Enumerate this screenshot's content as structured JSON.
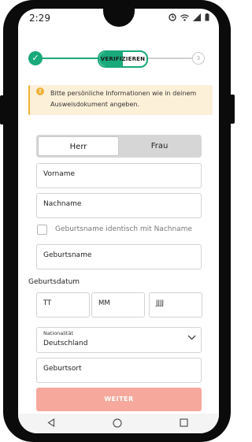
{
  "status_bar": {
    "time": "2:29",
    "icons": [
      "alarm-icon",
      "wifi-icon",
      "signal-icon",
      "battery-icon"
    ]
  },
  "stepper": {
    "done_icon": "✓",
    "current_label": "VERIFIZIEREN",
    "next_number": "3"
  },
  "alert": {
    "icon": "!",
    "text": "Bitte persönliche Informationen wie in deinem Ausweisdokument angeben."
  },
  "gender": {
    "options": [
      "Herr",
      "Frau"
    ],
    "selected": "Herr"
  },
  "fields": {
    "first_name": "Vorname",
    "last_name": "Nachname",
    "birth_name_checkbox": "Geburtsname identisch mit Nachname",
    "birth_name": "Geburtsname"
  },
  "birthdate": {
    "label": "Geburtsdatum",
    "day": "TT",
    "month": "MM",
    "year": "JJJJ"
  },
  "nationality": {
    "label": "Nationalität",
    "value": "Deutschland"
  },
  "birthplace": "Geburtsort",
  "submit_label": "WEITER",
  "colors": {
    "accent_green": "#19a97a",
    "alert_bg": "#fdf0d8",
    "alert_accent": "#f0b23a",
    "submit_disabled": "#f6a89c"
  },
  "nav": [
    "back-icon",
    "home-icon",
    "recents-icon"
  ]
}
